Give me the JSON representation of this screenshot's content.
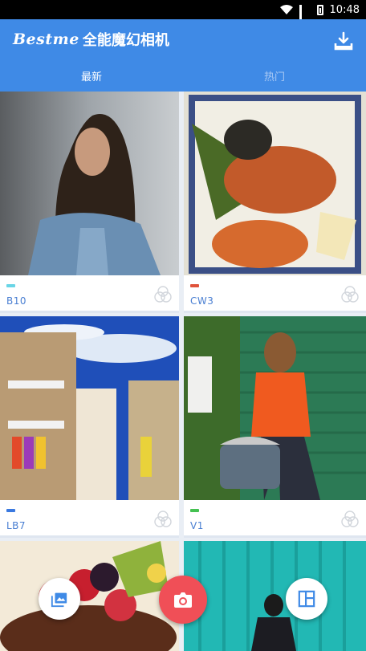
{
  "status_bar": {
    "time": "10:48"
  },
  "app_bar": {
    "logo_text": "Bestme",
    "title": "全能魔幻相机",
    "tabs": [
      {
        "label": "最新",
        "active": true
      },
      {
        "label": "热门",
        "active": false
      }
    ]
  },
  "filters": [
    {
      "label": "B10",
      "accent": "#69d5e6",
      "scene": "portrait-denim"
    },
    {
      "label": "CW3",
      "accent": "#e0533b",
      "scene": "sushi-plate"
    },
    {
      "label": "LB7",
      "accent": "#3a79e0",
      "scene": "colorful-buildings"
    },
    {
      "label": "V1",
      "accent": "#45c152",
      "scene": "orange-sweater-wall"
    },
    {
      "label": "",
      "accent": "",
      "scene": "berries-cake"
    },
    {
      "label": "",
      "accent": "",
      "scene": "teal-wall-person"
    }
  ],
  "fabs": {
    "gallery_icon": "gallery-icon",
    "camera_icon": "camera-icon",
    "layout_icon": "layout-icon"
  },
  "colors": {
    "primary": "#3f8ae6",
    "camera_fab": "#f04f57",
    "label_text": "#4a7fd2"
  }
}
